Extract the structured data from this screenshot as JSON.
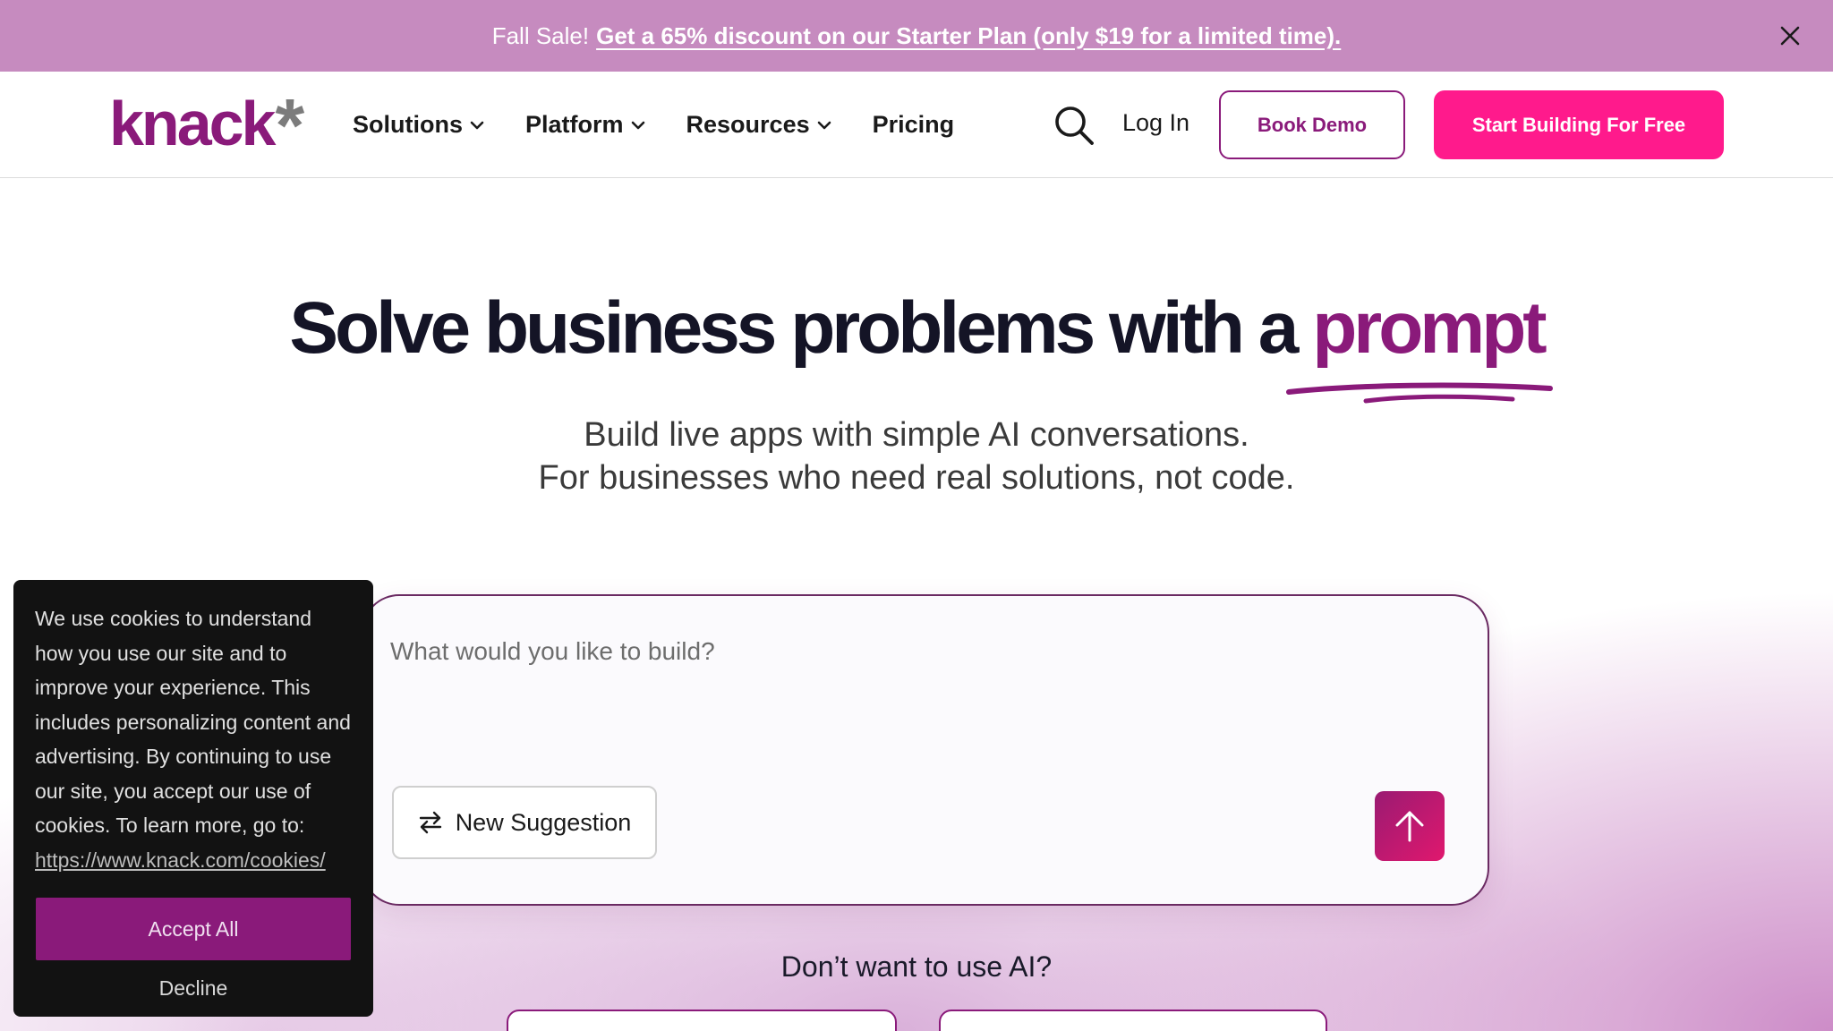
{
  "promo": {
    "lead": "Fall Sale!",
    "link": "Get a 65% discount on our Starter Plan (only $19 for a limited time)."
  },
  "header": {
    "logo_text": "knack",
    "logo_mark": "*",
    "nav": [
      {
        "label": "Solutions",
        "has_dropdown": true
      },
      {
        "label": "Platform",
        "has_dropdown": true
      },
      {
        "label": "Resources",
        "has_dropdown": true
      },
      {
        "label": "Pricing",
        "has_dropdown": false
      }
    ],
    "login": "Log In",
    "book_demo": "Book Demo",
    "start_free": "Start Building For Free"
  },
  "hero": {
    "title_main": "Solve business problems with a ",
    "title_accent": "prompt",
    "subtitle_line1": "Build live apps with simple AI conversations.",
    "subtitle_line2": "For businesses who need real solutions, not code."
  },
  "prompt": {
    "placeholder": "What would you like to build?",
    "suggestion_label": "New Suggestion"
  },
  "no_ai": {
    "heading": "Don’t want to use AI?"
  },
  "cookie": {
    "text": "We use cookies to understand how you use our site and to improve your experience. This includes personalizing content and advertising. By continuing to use our site, you accept our use of cookies. To learn more, go to:",
    "link": "https://www.knack.com/cookies/",
    "accept": "Accept All",
    "decline": "Decline"
  },
  "colors": {
    "brand_purple": "#8a1a7a",
    "brand_pink": "#ff1a8c",
    "promo_bg": "#c68bbf",
    "cookie_bg": "#121212"
  },
  "icons": {
    "close": "close-icon",
    "search": "search-icon",
    "chevron": "chevron-down-icon",
    "swap": "swap-arrows-icon",
    "send": "arrow-up-icon"
  }
}
